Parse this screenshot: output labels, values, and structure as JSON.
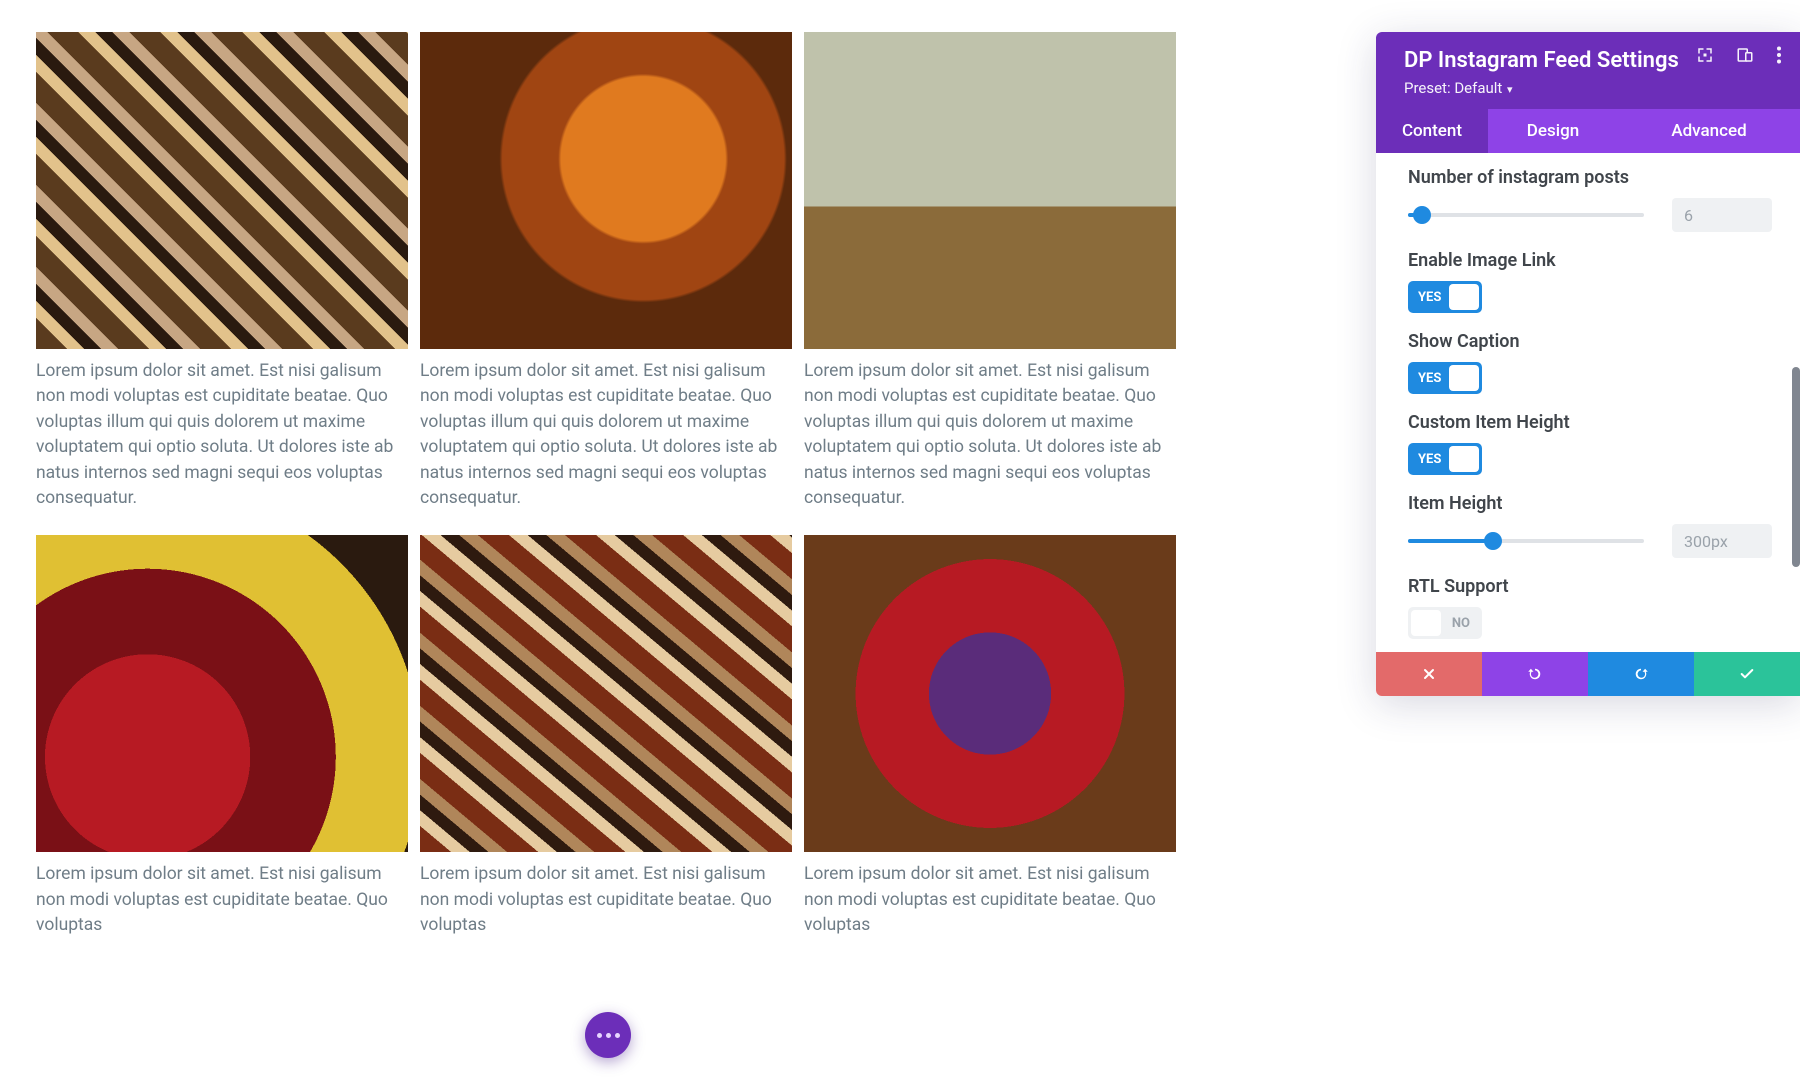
{
  "feed": {
    "caption": "Lorem ipsum dolor sit amet. Est nisi galisum non modi voluptas est cupiditate beatae. Quo voluptas illum qui quis dolorem ut maxime voluptatem qui optio soluta. Ut dolores iste ab natus internos sed magni sequi eos voluptas consequatur.",
    "caption_partial": "Lorem ipsum dolor sit amet. Est nisi galisum non modi voluptas est cupiditate beatae. Quo voluptas"
  },
  "panel": {
    "title": "DP Instagram Feed Settings",
    "preset_label": "Preset: Default",
    "tabs": {
      "content": "Content",
      "design": "Design",
      "advanced": "Advanced"
    },
    "settings": {
      "num_posts_label": "Number of instagram posts",
      "num_posts_value": "6",
      "enable_image_link_label": "Enable Image Link",
      "show_caption_label": "Show Caption",
      "custom_height_label": "Custom Item Height",
      "item_height_label": "Item Height",
      "item_height_value": "300px",
      "rtl_label": "RTL Support",
      "yes": "YES",
      "no": "NO"
    }
  }
}
